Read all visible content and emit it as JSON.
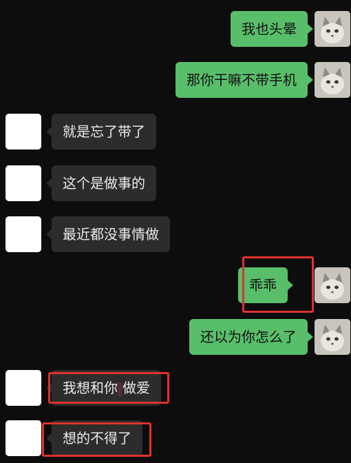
{
  "messages": [
    {
      "side": "sent",
      "text": "我也头晕"
    },
    {
      "side": "sent",
      "text": "那你干嘛不带手机"
    },
    {
      "side": "recv",
      "text": "就是忘了带了"
    },
    {
      "side": "recv",
      "text": "这个是做事的"
    },
    {
      "side": "recv",
      "text": "最近都没事情做"
    },
    {
      "side": "sent",
      "text": "乖乖",
      "highlighted": true
    },
    {
      "side": "sent",
      "text": "还以为你怎么了"
    },
    {
      "side": "recv",
      "text_before": "我想和你",
      "text_after": "做爱",
      "highlighted": true,
      "partially_obscured": true
    },
    {
      "side": "recv",
      "text": "想的不得了",
      "highlighted": true
    }
  ],
  "colors": {
    "background": "#0d0d0d",
    "sent_bubble": "#58be6a",
    "received_bubble": "#2c2c2c",
    "highlight_box": "#e0322e"
  },
  "icons": {
    "sent_avatar": "cat-avatar-icon",
    "received_avatar": "blank-avatar"
  }
}
